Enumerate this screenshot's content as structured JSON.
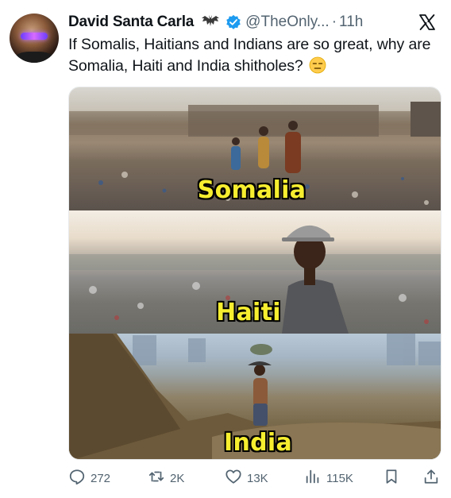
{
  "author": {
    "display_name": "David Santa Carla",
    "handle": "@TheOnly...",
    "separator": "·",
    "time": "11h",
    "badge_icons": [
      "bat-icon",
      "verified-icon"
    ]
  },
  "tweet": {
    "text": "If Somalis, Haitians and Indians are so great, why are Somalia, Haiti and India shitholes?",
    "emoji_icon": "expressionless-face-icon"
  },
  "media": {
    "captions": [
      "Somalia",
      "Haiti",
      "India"
    ]
  },
  "actions": {
    "replies": "272",
    "retweets": "2K",
    "likes": "13K",
    "views": "115K"
  },
  "colors": {
    "text": "#0f1419",
    "secondary": "#536471",
    "verified": "#1d9bf0",
    "caption": "#f6ee2f"
  }
}
